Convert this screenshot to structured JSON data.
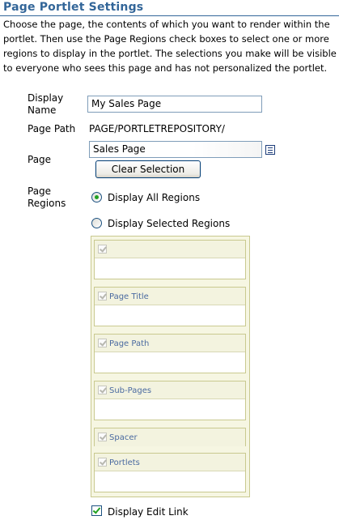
{
  "header": {
    "title": "Page Portlet Settings",
    "intro_lines": [
      "Choose the page, the contents of which you want to render within the",
      "portlet. Then use the Page Regions check boxes to select one or more",
      "regions to display in the portlet. The selections you make will be visible",
      "to everyone who sees this page and has not personalized the portlet."
    ]
  },
  "form": {
    "display_name_label_1": "Display",
    "display_name_label_2": "Name",
    "display_name_value": "My Sales Page",
    "page_path_label": "Page Path",
    "page_path_value": "PAGE/PORTLETREPOSITORY/",
    "page_label": "Page",
    "page_value": "Sales Page",
    "lookup_icon": "list-lookup-icon",
    "clear_selection_label": "Clear Selection",
    "page_regions_label_1": "Page",
    "page_regions_label_2": "Regions",
    "radio_all_label": "Display All Regions",
    "radio_all_selected": true,
    "radio_selected_label": "Display Selected Regions",
    "radio_selected_selected": false,
    "regions": [
      {
        "name": "",
        "checked": true
      },
      {
        "name": "Page Title",
        "checked": true
      },
      {
        "name": "Page Path",
        "checked": true
      },
      {
        "name": "Sub-Pages",
        "checked": true
      },
      {
        "name": "Spacer",
        "checked": true
      },
      {
        "name": "Portlets",
        "checked": true
      }
    ],
    "display_edit_link_label": "Display Edit Link",
    "display_edit_link_checked": true
  },
  "colors": {
    "title": "#336699",
    "region_border": "#c9c98f",
    "region_label": "#4a6aa0",
    "check_green": "#21a121"
  }
}
